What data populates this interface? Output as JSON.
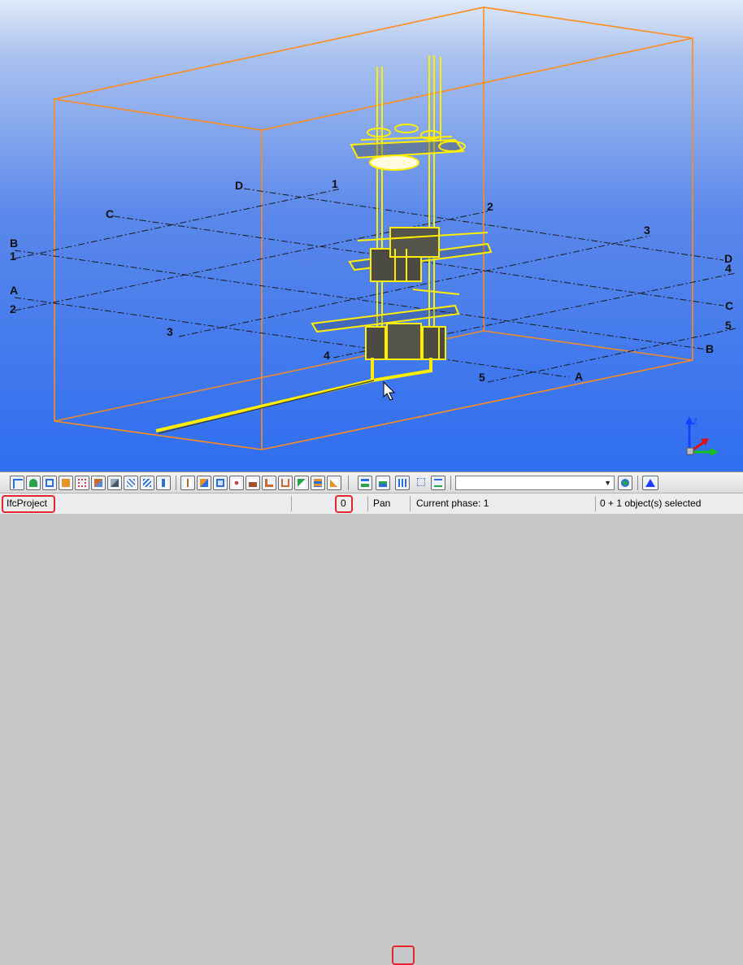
{
  "grid_labels": {
    "letters": [
      "A",
      "B",
      "C",
      "D"
    ],
    "numbers": [
      "1",
      "2",
      "3",
      "4",
      "5"
    ]
  },
  "toolbar": {
    "buttons": [
      "select-icon",
      "tree-icon",
      "box-view-icon",
      "wall-icon",
      "grid-icon",
      "slab-icon",
      "beam-icon",
      "mesh-icon",
      "rebar-icon",
      "column-icon",
      "pen-icon",
      "layer-icon",
      "dots-icon",
      "plug-icon",
      "bucket-icon",
      "pipe-icon",
      "stack-icon",
      "brush-icon",
      "marker-a-icon",
      "marker-b-icon",
      "phase-icon",
      "dotted-icon",
      "line-icon"
    ],
    "phase_dropdown_value": "",
    "colors": {
      "highlight": "#e3262e",
      "model": "#ffee00",
      "bbox": "#ff8c1a"
    }
  },
  "status": {
    "project": "IfcProject",
    "count": "0",
    "mode": "Pan",
    "phase": "Current phase: 1",
    "selection": "0 + 1 object(s) selected"
  }
}
